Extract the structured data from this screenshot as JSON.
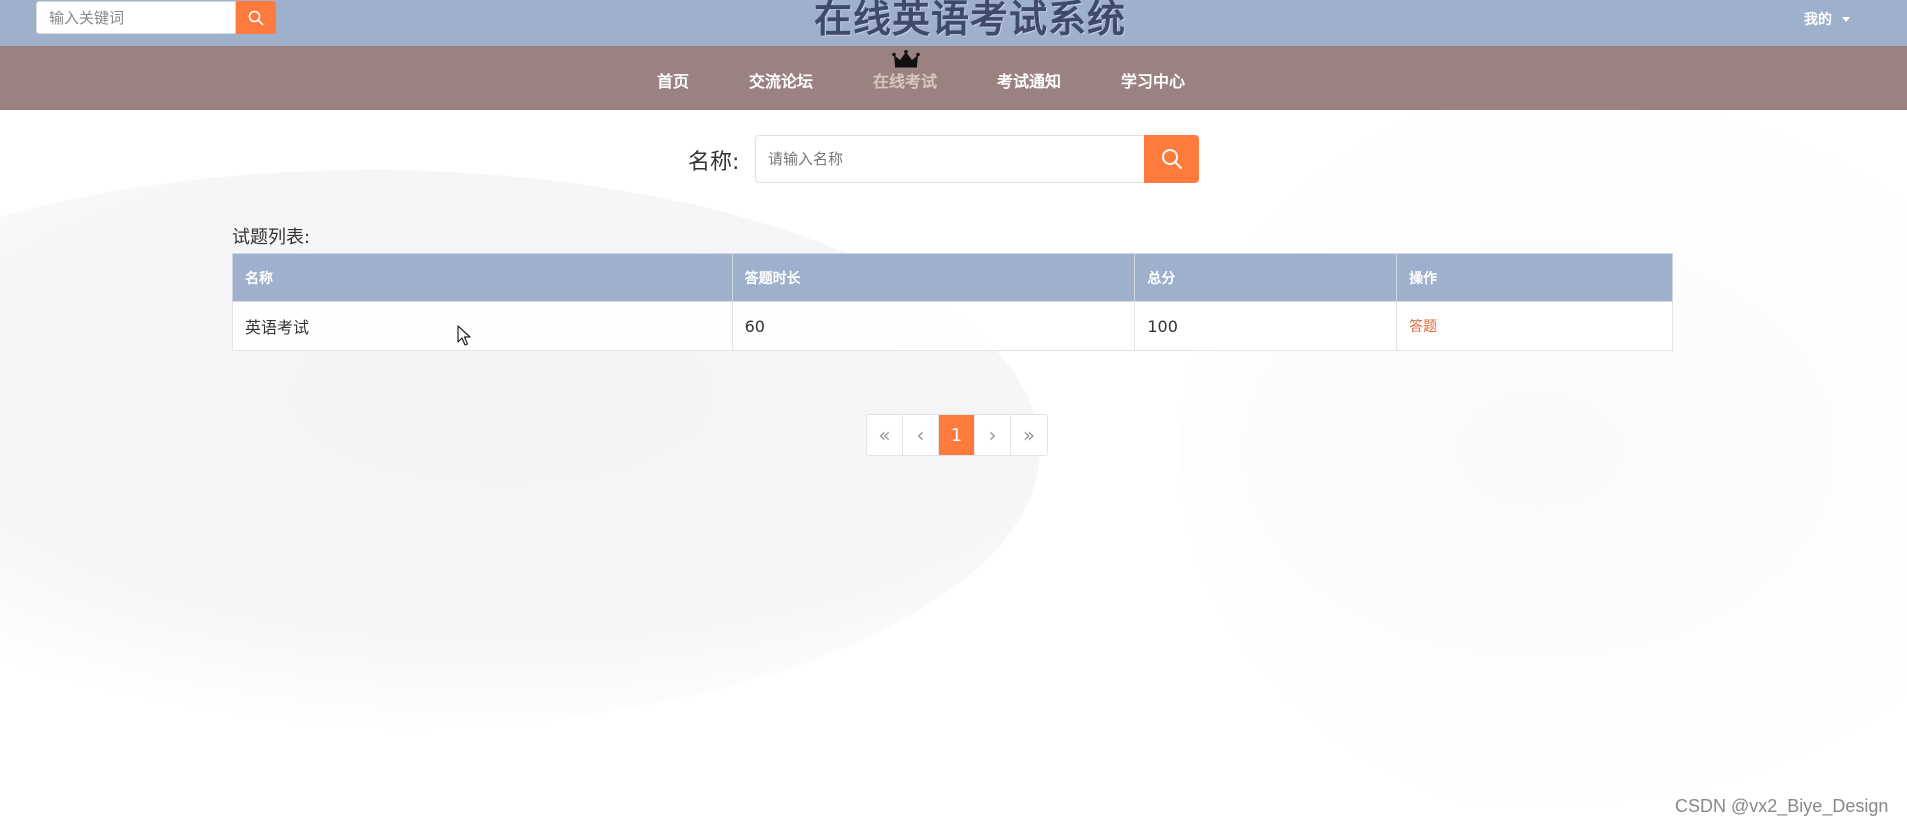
{
  "header": {
    "search_placeholder": "输入关键词",
    "site_title": "在线英语考试系统",
    "user_menu_label": "我的"
  },
  "nav": {
    "items": [
      {
        "label": "首页",
        "active": false
      },
      {
        "label": "交流论坛",
        "active": false
      },
      {
        "label": "在线考试",
        "active": true
      },
      {
        "label": "考试通知",
        "active": false
      },
      {
        "label": "学习中心",
        "active": false
      }
    ]
  },
  "search": {
    "label": "名称:",
    "placeholder": "请输入名称"
  },
  "list": {
    "title": "试题列表:",
    "columns": [
      "名称",
      "答题时长",
      "总分",
      "操作"
    ],
    "rows": [
      {
        "name": "英语考试",
        "duration": "60",
        "total_score": "100",
        "action": "答题"
      }
    ]
  },
  "pagination": {
    "first": "«",
    "prev": "‹",
    "current": "1",
    "next": "›",
    "last": "»"
  },
  "watermark": "CSDN @vx2_Biye_Design",
  "colors": {
    "topbar": "#9fb0cc",
    "navbar": "#9a8280",
    "accent": "#ff7a3d",
    "table_header": "#9fb0cc",
    "action_link": "#e0683a"
  },
  "icons": [
    "search-icon",
    "crown-icon",
    "chevron-down-icon",
    "mouse-cursor-icon"
  ]
}
